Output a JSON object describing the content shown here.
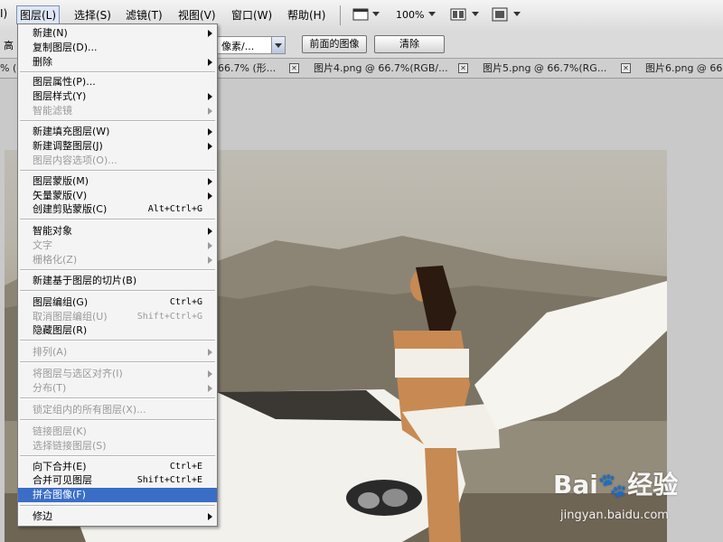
{
  "menubar": {
    "items": [
      "I)",
      "图层(L)",
      "选择(S)",
      "滤镜(T)",
      "视图(V)",
      "窗口(W)",
      "帮助(H)"
    ],
    "zoom": "100%"
  },
  "options": {
    "left_text": "高",
    "sample_select": "像素/...",
    "front_image_button": "前面的图像",
    "clear_button": "清除"
  },
  "tabs": [
    "% (",
    "66.7% (形...",
    "图片4.png @ 66.7%(RGB/...",
    "图片5.png @ 66.7%(RG...",
    "图片6.png @ 66.7%"
  ],
  "layer_menu": {
    "items": [
      {
        "label": "新建(N)",
        "submenu": true
      },
      {
        "label": "复制图层(D)..."
      },
      {
        "label": "删除",
        "submenu": true
      },
      {
        "label": "图层属性(P)..."
      },
      {
        "label": "图层样式(Y)",
        "submenu": true
      },
      {
        "label": "智能滤镜",
        "disabled": true,
        "submenu": true
      },
      {
        "label": "新建填充图层(W)",
        "submenu": true
      },
      {
        "label": "新建调整图层(J)",
        "submenu": true
      },
      {
        "label": "图层内容选项(O)...",
        "disabled": true
      },
      {
        "label": "图层蒙版(M)",
        "submenu": true
      },
      {
        "label": "矢量蒙版(V)",
        "submenu": true
      },
      {
        "label": "创建剪贴蒙版(C)",
        "shortcut": "Alt+Ctrl+G"
      },
      {
        "label": "智能对象",
        "submenu": true
      },
      {
        "label": "文字",
        "disabled": true,
        "submenu": true
      },
      {
        "label": "栅格化(Z)",
        "disabled": true,
        "submenu": true
      },
      {
        "label": "新建基于图层的切片(B)"
      },
      {
        "label": "图层编组(G)",
        "shortcut": "Ctrl+G"
      },
      {
        "label": "取消图层编组(U)",
        "shortcut": "Shift+Ctrl+G",
        "disabled": true
      },
      {
        "label": "隐藏图层(R)"
      },
      {
        "label": "排列(A)",
        "disabled": true,
        "submenu": true
      },
      {
        "label": "将图层与选区对齐(I)",
        "disabled": true,
        "submenu": true
      },
      {
        "label": "分布(T)",
        "disabled": true,
        "submenu": true
      },
      {
        "label": "锁定组内的所有图层(X)...",
        "disabled": true
      },
      {
        "label": "链接图层(K)",
        "disabled": true
      },
      {
        "label": "选择链接图层(S)",
        "disabled": true
      },
      {
        "label": "向下合并(E)",
        "shortcut": "Ctrl+E"
      },
      {
        "label": "合并可见图层",
        "shortcut": "Shift+Ctrl+E"
      },
      {
        "label": "拼合图像(F)",
        "highlighted": true
      },
      {
        "label": "修边",
        "submenu": true
      }
    ]
  },
  "watermark": {
    "brand": "Bai",
    "brand2": "经验",
    "url": "jingyan.baidu.com"
  },
  "colors": {
    "menu_highlight": "#3a6ec6",
    "menu_bg": "#f4f4f4",
    "disabled_text": "#9a9a9a"
  }
}
